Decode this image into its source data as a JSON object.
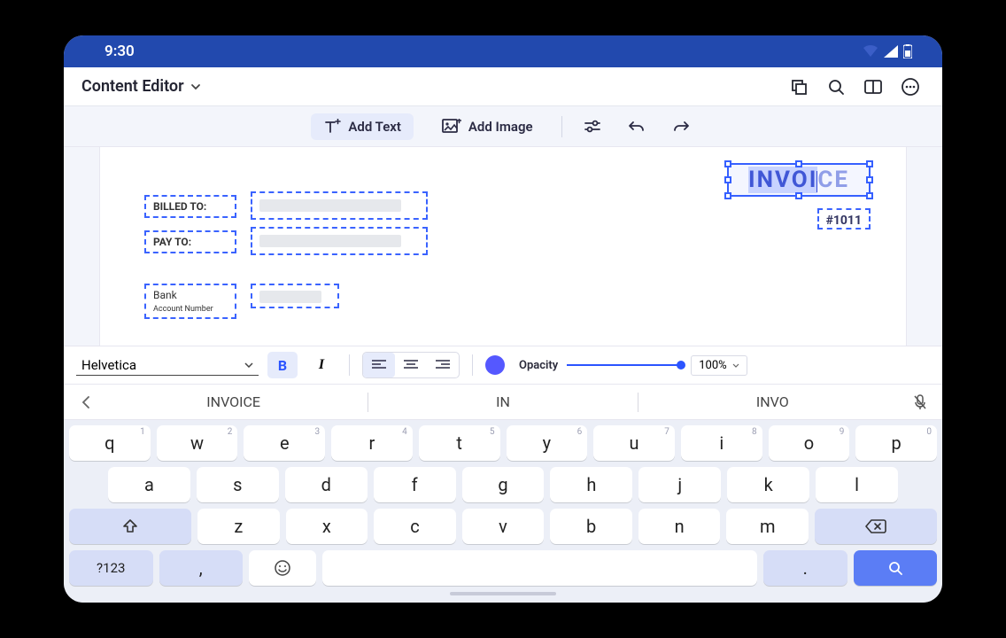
{
  "status": {
    "time": "9:30"
  },
  "appbar": {
    "title": "Content Editor"
  },
  "toolbar": {
    "add_text": "Add Text",
    "add_image": "Add Image"
  },
  "doc": {
    "invoice_selected": "INVOI",
    "invoice_rest": "CE",
    "invoice_number": "#1011",
    "billed_to": "BILLED TO:",
    "pay_to": "PAY TO:",
    "bank": "Bank",
    "acct": "Account Number"
  },
  "format": {
    "font": "Helvetica",
    "opacity_label": "Opacity",
    "opacity_value": "100%",
    "color": "#5558FF"
  },
  "suggestions": {
    "s1": "INVOICE",
    "s2": "IN",
    "s3": "INVO"
  },
  "keys": {
    "row1": [
      "q",
      "w",
      "e",
      "r",
      "t",
      "y",
      "u",
      "i",
      "o",
      "p"
    ],
    "row1_hints": [
      "1",
      "2",
      "3",
      "4",
      "5",
      "6",
      "7",
      "8",
      "9",
      "0"
    ],
    "row2": [
      "a",
      "s",
      "d",
      "f",
      "g",
      "h",
      "j",
      "k",
      "l"
    ],
    "row3": [
      "z",
      "x",
      "c",
      "v",
      "b",
      "n",
      "m"
    ],
    "sym": "?123",
    "comma": ",",
    "period": "."
  }
}
